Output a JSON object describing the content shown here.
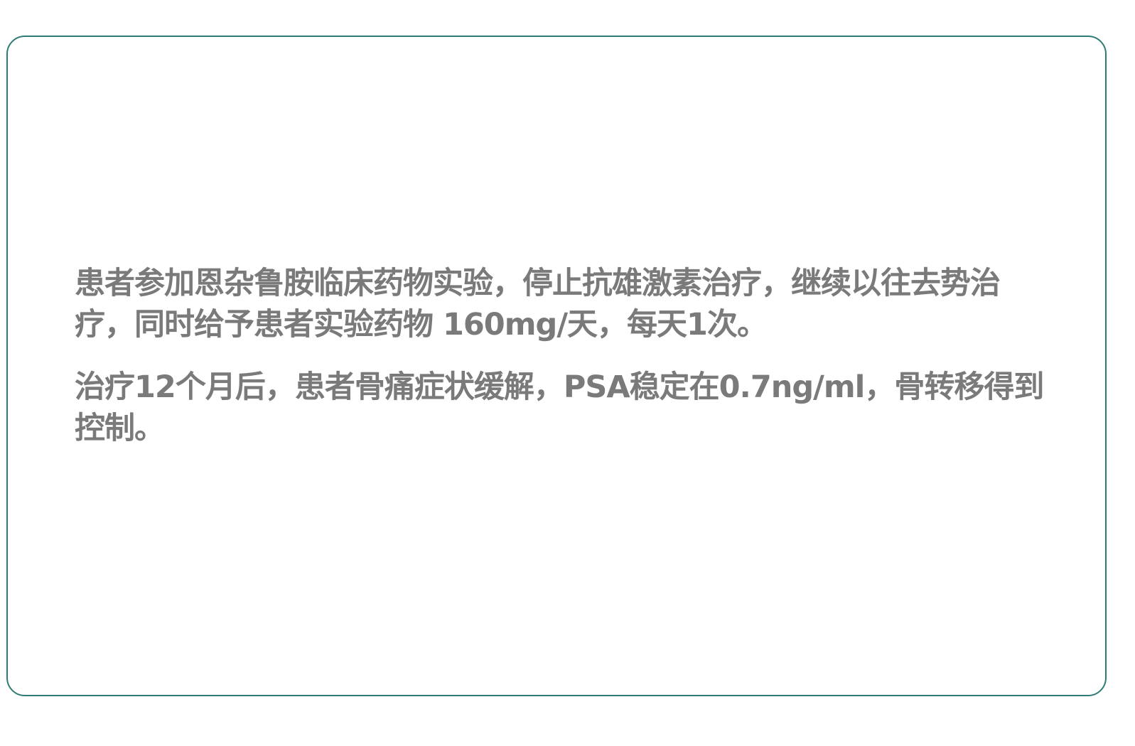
{
  "case": {
    "paragraphs": [
      "患者参加恩杂鲁胺临床药物实验，停止抗雄激素治疗，继续以往去势治疗，同时给予患者实验药物 160mg/天，每天1次。",
      "治疗12个月后，患者骨痛症状缓解，PSA稳定在0.7ng/ml，骨转移得到控制。"
    ]
  },
  "colors": {
    "border": "#2e7d74",
    "text": "#7a7a7a",
    "background": "#ffffff"
  }
}
